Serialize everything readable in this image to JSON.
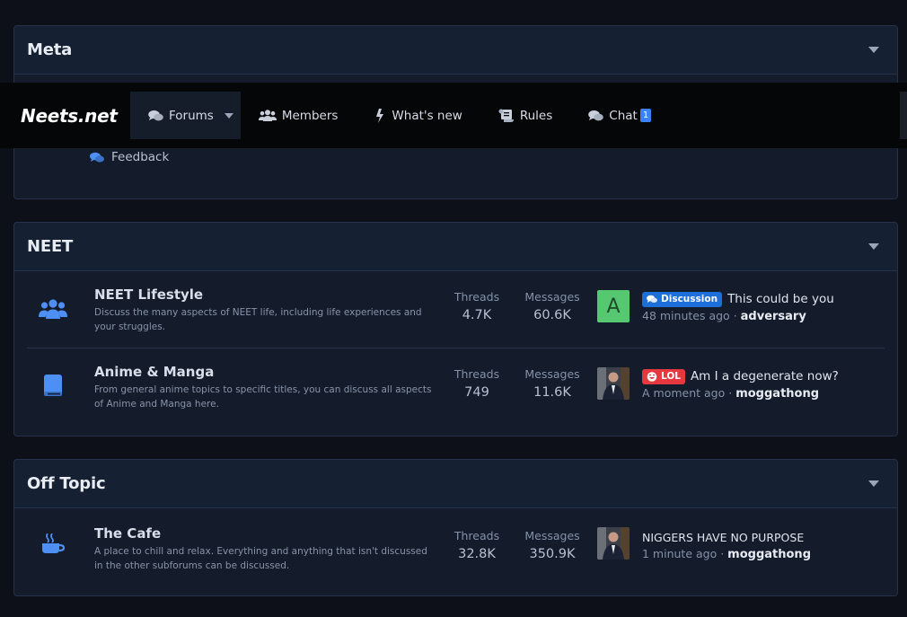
{
  "navbar": {
    "logo": "Neets.net",
    "tabs": [
      {
        "label": "Forums",
        "icon": "comments-icon"
      },
      {
        "label": "Members",
        "icon": "users-icon"
      },
      {
        "label": "What's new",
        "icon": "bolt-icon"
      },
      {
        "label": "Rules",
        "icon": "scroll-icon"
      },
      {
        "label": "Chat",
        "icon": "comments-icon",
        "badge": "1"
      }
    ]
  },
  "meta": {
    "title": "Meta",
    "links": [
      {
        "label": "Feedback",
        "icon": "comments-icon"
      }
    ]
  },
  "categories": [
    {
      "title": "NEET",
      "nodes": [
        {
          "title": "NEET Lifestyle",
          "icon": "users-icon",
          "description": "Discuss the many aspects of NEET life, including life experiences and your struggles.",
          "threads_label": "Threads",
          "threads": "4.7K",
          "messages_label": "Messages",
          "messages": "60.6K",
          "latest": {
            "avatar_letter": "A",
            "prefix": "Discussion",
            "prefix_color": "#1d6ed8",
            "title": "This could be you",
            "time": "48 minutes ago",
            "user": "adversary"
          }
        },
        {
          "title": "Anime & Manga",
          "icon": "book-icon",
          "description": "From general anime topics to specific titles, you can discuss all aspects of Anime and Manga here.",
          "threads_label": "Threads",
          "threads": "749",
          "messages_label": "Messages",
          "messages": "11.6K",
          "latest": {
            "prefix": "LOL",
            "prefix_color": "#e5393f",
            "title": "Am I a degenerate now?",
            "time": "A moment ago",
            "user": "moggathong"
          }
        }
      ]
    },
    {
      "title": "Off Topic",
      "nodes": [
        {
          "title": "The Cafe",
          "icon": "coffee-icon",
          "description": "A place to chill and relax. Everything and anything that isn't discussed in the other subforums can be discussed.",
          "threads_label": "Threads",
          "threads": "32.8K",
          "messages_label": "Messages",
          "messages": "350.9K",
          "latest": {
            "title": "NIGGERS HAVE NO PURPOSE",
            "time": "1 minute ago",
            "user": "moggathong"
          }
        }
      ]
    }
  ],
  "colors": {
    "accent": "#3b82f6",
    "background": "#0d1018",
    "block": "#141c2b"
  }
}
